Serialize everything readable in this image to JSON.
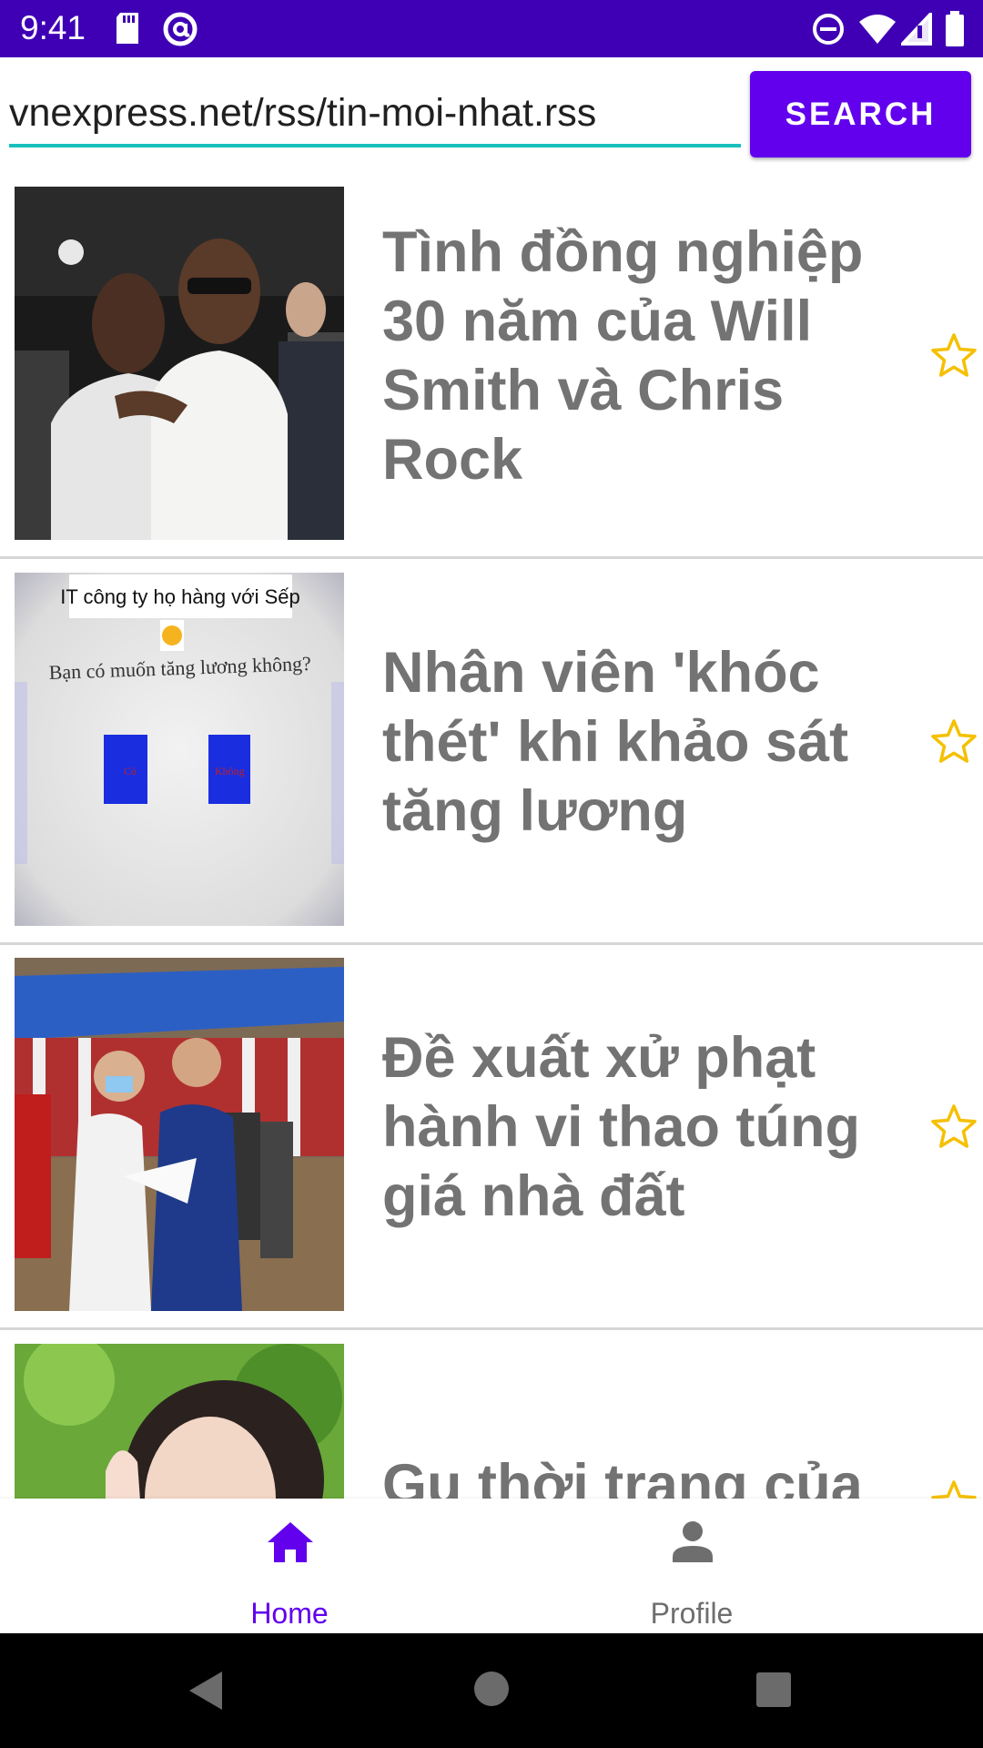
{
  "status_bar": {
    "time": "9:41",
    "left_icons": [
      "sd-card-icon",
      "at-sign-icon"
    ],
    "right_icons": [
      "do-not-disturb-icon",
      "wifi-icon",
      "cell-signal-icon",
      "battery-icon"
    ],
    "background": "#3f00b5"
  },
  "search": {
    "url_value": "vnexpress.net/rss/tin-moi-nhat.rss",
    "button_label": "SEARCH",
    "accent": "#6200ee",
    "underline_color": "#18c0bc"
  },
  "articles": [
    {
      "title": "Tình đồng nghiệp 30 năm của Will Smith và Chris Rock",
      "starred": false
    },
    {
      "title": "Nhân viên 'khóc thét' khi khảo sát tăng lương",
      "starred": false,
      "thumb_text": {
        "caption": "IT công ty họ hàng với Sếp",
        "question": "Bạn có muốn tăng lương không?",
        "option_yes": "Có",
        "option_no": "Không"
      }
    },
    {
      "title": "Đề xuất xử phạt hành vi thao túng giá nhà đất",
      "starred": false
    },
    {
      "title": "Gu thời trang của",
      "starred": false
    }
  ],
  "bottom_nav": {
    "items": [
      {
        "label": "Home",
        "icon": "home-icon",
        "active": true
      },
      {
        "label": "Profile",
        "icon": "person-icon",
        "active": false
      }
    ],
    "active_color": "#6200ee",
    "inactive_color": "#6e6e6e"
  },
  "system_nav": {
    "buttons": [
      "back-icon",
      "home-circle-icon",
      "recents-icon"
    ]
  }
}
